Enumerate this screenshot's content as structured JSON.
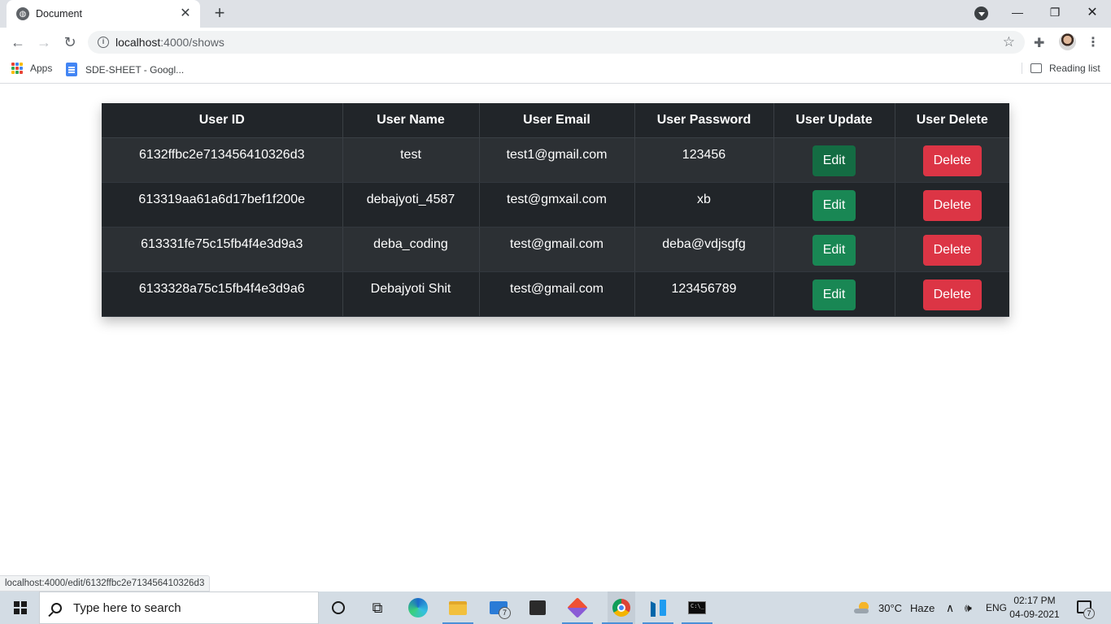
{
  "browser": {
    "tab_title": "Document",
    "url_host": "localhost",
    "url_port_path": ":4000/shows",
    "bookmarks": [
      "Apps",
      "SDE-SHEET - Googl..."
    ],
    "reading_list": "Reading list",
    "status_link": "localhost:4000/edit/6132ffbc2e713456410326d3"
  },
  "table": {
    "headers": [
      "User ID",
      "User Name",
      "User Email",
      "User Password",
      "User Update",
      "User Delete"
    ],
    "edit_label": "Edit",
    "delete_label": "Delete",
    "rows": [
      {
        "id": "6132ffbc2e713456410326d3",
        "name": "test",
        "email": "test1@gmail.com",
        "password": "123456"
      },
      {
        "id": "613319aa61a6d17bef1f200e",
        "name": "debajyoti_4587",
        "email": "test@gmxail.com",
        "password": "xb"
      },
      {
        "id": "613331fe75c15fb4f4e3d9a3",
        "name": "deba_coding",
        "email": "test@gmail.com",
        "password": "deba@vdjsgfg"
      },
      {
        "id": "6133328a75c15fb4f4e3d9a6",
        "name": "Debajyoti Shit",
        "email": "test@gmail.com",
        "password": "123456789"
      }
    ]
  },
  "taskbar": {
    "search_placeholder": "Type here to search",
    "mail_badge": "7",
    "weather": "30°C",
    "weather_desc": "Haze",
    "language": "ENG",
    "time": "02:17 PM",
    "date": "04-09-2021",
    "notif_badge": "7"
  }
}
